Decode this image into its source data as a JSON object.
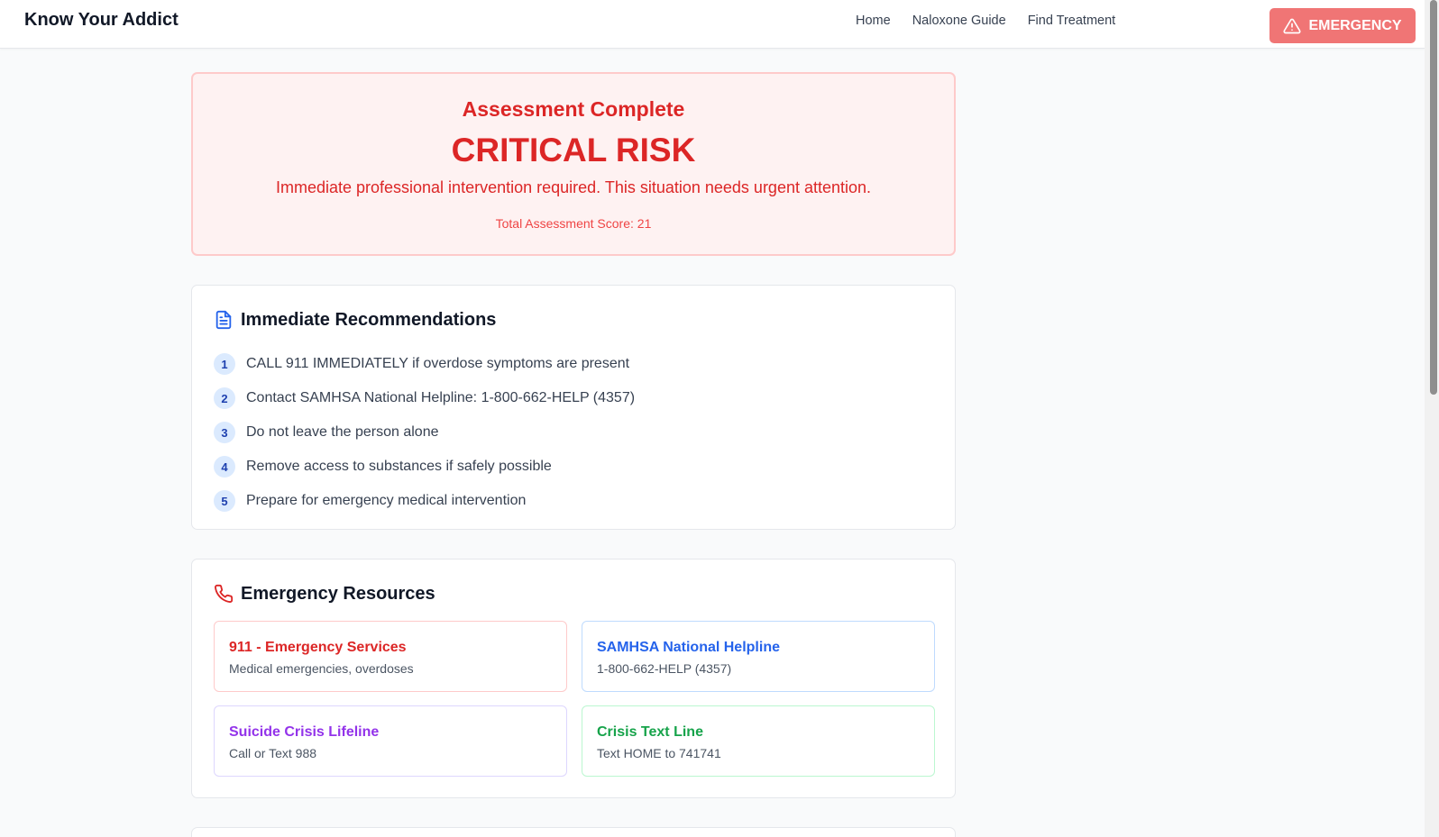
{
  "header": {
    "brand": "Know Your Addict",
    "nav": [
      "Home",
      "Naloxone Guide",
      "Find Treatment"
    ],
    "emergency_label": "EMERGENCY"
  },
  "result": {
    "heading": "Assessment Complete",
    "risk_level": "CRITICAL RISK",
    "description": "Immediate professional intervention required. This situation needs urgent attention.",
    "score_text": "Total Assessment Score: 21"
  },
  "recommendations": {
    "title": "Immediate Recommendations",
    "items": [
      {
        "num": "1",
        "text": "CALL 911 IMMEDIATELY if overdose symptoms are present"
      },
      {
        "num": "2",
        "text": "Contact SAMHSA National Helpline: 1-800-662-HELP (4357)"
      },
      {
        "num": "3",
        "text": "Do not leave the person alone"
      },
      {
        "num": "4",
        "text": "Remove access to substances if safely possible"
      },
      {
        "num": "5",
        "text": "Prepare for emergency medical intervention"
      }
    ]
  },
  "resources": {
    "title": "Emergency Resources",
    "items": [
      {
        "title": "911 - Emergency Services",
        "subtitle": "Medical emergencies, overdoses",
        "color": "#dc2626",
        "border": "#fecaca"
      },
      {
        "title": "SAMHSA National Helpline",
        "subtitle": "1-800-662-HELP (4357)",
        "color": "#2563eb",
        "border": "#bfdbfe"
      },
      {
        "title": "Suicide Crisis Lifeline",
        "subtitle": "Call or Text 988",
        "color": "#9333ea",
        "border": "#ddd6fe"
      },
      {
        "title": "Crisis Text Line",
        "subtitle": "Text HOME to 741741",
        "color": "#16a34a",
        "border": "#bbf7d0"
      }
    ]
  },
  "colors": {
    "critical": "#dc2626",
    "emergency_button": "#f07575",
    "accent_blue": "#2563eb"
  },
  "icons": {
    "emergency": "warning-triangle-icon",
    "recommendations": "document-icon",
    "resources": "phone-icon"
  }
}
